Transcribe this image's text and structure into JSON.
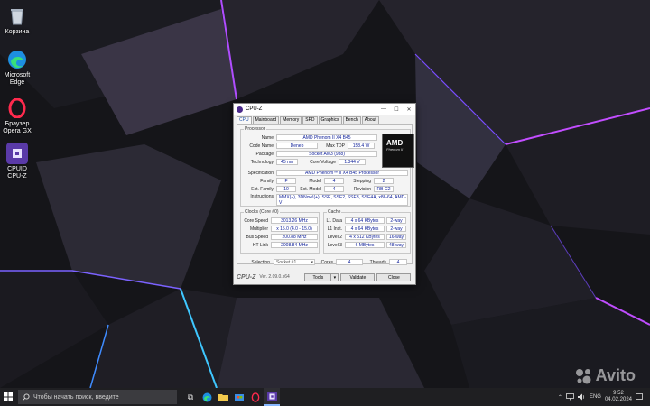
{
  "desktop": {
    "icons": [
      {
        "label": "Корзина",
        "icon": "recycle-bin-icon"
      },
      {
        "label": "Microsoft\nEdge",
        "icon": "edge-icon"
      },
      {
        "label": "Браузер\nOpera GX",
        "icon": "opera-gx-icon"
      },
      {
        "label": "CPUID\nCPU-Z",
        "icon": "cpu-z-icon"
      }
    ]
  },
  "window": {
    "title": "CPU-Z",
    "tabs": [
      "CPU",
      "Mainboard",
      "Memory",
      "SPD",
      "Graphics",
      "Bench",
      "About"
    ],
    "processor": {
      "group": "Processor",
      "name_label": "Name",
      "name": "AMD Phenom II X4 B45",
      "codename_label": "Code Name",
      "codename": "Deneb",
      "maxtdp_label": "Max TDP",
      "maxtdp": "158.4 W",
      "package_label": "Package",
      "package": "Socket AM3 (938)",
      "technology_label": "Technology",
      "technology": "45 nm",
      "corevoltage_label": "Core Voltage",
      "corevoltage": "1.344 V",
      "spec_label": "Specification",
      "spec": "AMD Phenom™ II X4 B45 Processor",
      "family_label": "Family",
      "family": "F",
      "model_label": "Model",
      "model": "4",
      "stepping_label": "Stepping",
      "stepping": "2",
      "extfamily_label": "Ext. Family",
      "extfamily": "10",
      "extmodel_label": "Ext. Model",
      "extmodel": "4",
      "revision_label": "Revision",
      "revision": "RB-C2",
      "instructions_label": "Instructions",
      "instructions": "MMX(+), 3DNow!(+), SSE, SSE2, SSE3, SSE4A, x86-64, AMD-V",
      "logo_brand": "AMD",
      "logo_sub": "Phenom II"
    },
    "clocks": {
      "group": "Clocks (Core #0)",
      "corespeed_label": "Core Speed",
      "corespeed": "3013.26 MHz",
      "multiplier_label": "Multiplier",
      "multiplier": "x 15.0 (4.0 - 15.0)",
      "busspeed_label": "Bus Speed",
      "busspeed": "200.88 MHz",
      "htlink_label": "HT Link",
      "htlink": "2008.84 MHz"
    },
    "cache": {
      "group": "Cache",
      "l1data_label": "L1 Data",
      "l1data": "4 x 64 KBytes",
      "l1data_way": "2-way",
      "l1inst_label": "L1 Inst.",
      "l1inst": "4 x 64 KBytes",
      "l1inst_way": "2-way",
      "level2_label": "Level 2",
      "level2": "4 x 512 KBytes",
      "level2_way": "16-way",
      "level3_label": "Level 3",
      "level3": "6 MBytes",
      "level3_way": "48-way"
    },
    "selection": {
      "label": "Selection",
      "socket": "Socket #1",
      "cores_label": "Cores",
      "cores": "4",
      "threads_label": "Threads",
      "threads": "4"
    },
    "footer": {
      "logo": "CPU-Z",
      "version": "Ver. 2.09.0.x64",
      "tools": "Tools",
      "validate": "Validate",
      "close": "Close"
    }
  },
  "taskbar": {
    "search_placeholder": "Чтобы начать поиск, введите",
    "lang": "ENG",
    "time": "9:52",
    "date": "04.02.2024"
  },
  "watermark": "Avito",
  "colors": {
    "value_text": "#11229a",
    "taskbar": "#1f1f22",
    "accent": "#88b8ff"
  }
}
